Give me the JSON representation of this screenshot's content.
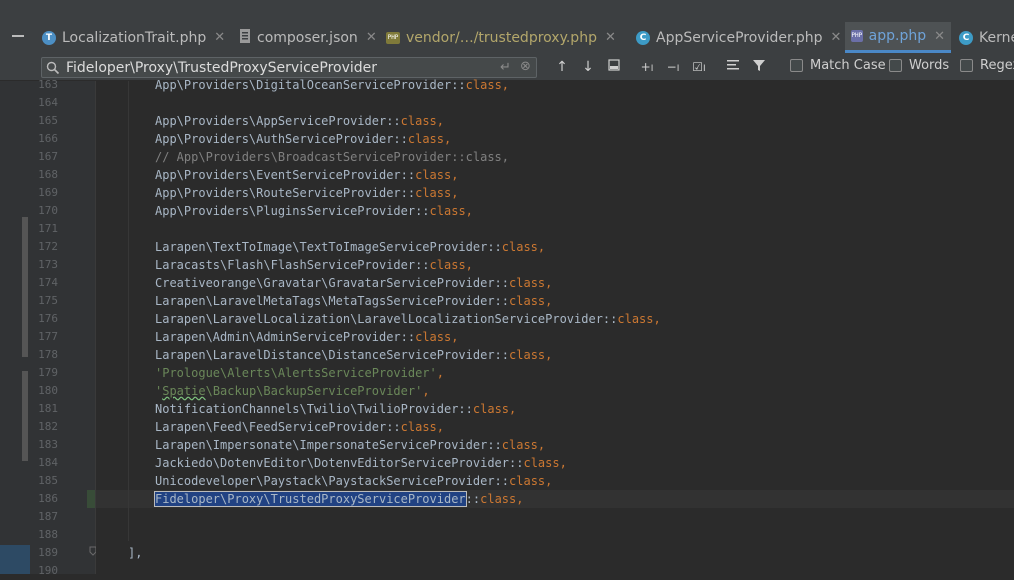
{
  "tabs": [
    {
      "label": "LocalizationTrait.php",
      "icon": "php-trait-icon",
      "active": false,
      "closable": true
    },
    {
      "label": "composer.json",
      "icon": "json-file-icon",
      "active": false,
      "closable": true
    },
    {
      "label": "vendor/…/trustedproxy.php",
      "icon": "php-file-icon",
      "active": false,
      "closable": true
    },
    {
      "label": "AppServiceProvider.php",
      "icon": "php-class-icon",
      "active": false,
      "closable": true
    },
    {
      "label": "app.php",
      "icon": "php-file-icon",
      "active": true,
      "closable": true
    },
    {
      "label": "Kerne",
      "icon": "php-class-icon",
      "active": false,
      "closable": false
    }
  ],
  "search": {
    "value": "Fideloper\\Proxy\\TrustedProxyServiceProvider",
    "match_case_label": "Match Case",
    "words_label": "Words",
    "regex_label": "Regex"
  },
  "lines": [
    {
      "n": "163",
      "segments": [
        {
          "t": "App\\Providers\\DigitalOceanServiceProvider::",
          "c": ""
        },
        {
          "t": "class",
          "c": "kw"
        },
        {
          "t": ",",
          "c": "kw"
        }
      ]
    },
    {
      "n": "164",
      "segments": []
    },
    {
      "n": "165",
      "segments": [
        {
          "t": "App\\Providers\\AppServiceProvider::",
          "c": ""
        },
        {
          "t": "class",
          "c": "kw"
        },
        {
          "t": ",",
          "c": "kw"
        }
      ]
    },
    {
      "n": "166",
      "segments": [
        {
          "t": "App\\Providers\\AuthServiceProvider::",
          "c": ""
        },
        {
          "t": "class",
          "c": "kw"
        },
        {
          "t": ",",
          "c": "kw"
        }
      ]
    },
    {
      "n": "167",
      "segments": [
        {
          "t": "// App\\Providers\\BroadcastServiceProvider::class,",
          "c": "cm"
        }
      ]
    },
    {
      "n": "168",
      "segments": [
        {
          "t": "App\\Providers\\EventServiceProvider::",
          "c": ""
        },
        {
          "t": "class",
          "c": "kw"
        },
        {
          "t": ",",
          "c": "kw"
        }
      ]
    },
    {
      "n": "169",
      "segments": [
        {
          "t": "App\\Providers\\RouteServiceProvider::",
          "c": ""
        },
        {
          "t": "class",
          "c": "kw"
        },
        {
          "t": ",",
          "c": "kw"
        }
      ]
    },
    {
      "n": "170",
      "segments": [
        {
          "t": "App\\Providers\\PluginsServiceProvider::",
          "c": ""
        },
        {
          "t": "class",
          "c": "kw"
        },
        {
          "t": ",",
          "c": "kw"
        }
      ]
    },
    {
      "n": "171",
      "segments": []
    },
    {
      "n": "172",
      "segments": [
        {
          "t": "Larapen\\TextToImage\\TextToImageServiceProvider::",
          "c": ""
        },
        {
          "t": "class",
          "c": "kw"
        },
        {
          "t": ",",
          "c": "kw"
        }
      ]
    },
    {
      "n": "173",
      "segments": [
        {
          "t": "Laracasts\\Flash\\FlashServiceProvider::",
          "c": ""
        },
        {
          "t": "class",
          "c": "kw"
        },
        {
          "t": ",",
          "c": "kw"
        }
      ]
    },
    {
      "n": "174",
      "segments": [
        {
          "t": "Creativeorange\\Gravatar\\GravatarServiceProvider::",
          "c": ""
        },
        {
          "t": "class",
          "c": "kw"
        },
        {
          "t": ",",
          "c": "kw"
        }
      ]
    },
    {
      "n": "175",
      "segments": [
        {
          "t": "Larapen\\LaravelMetaTags\\MetaTagsServiceProvider::",
          "c": ""
        },
        {
          "t": "class",
          "c": "kw"
        },
        {
          "t": ",",
          "c": "kw"
        }
      ]
    },
    {
      "n": "176",
      "segments": [
        {
          "t": "Larapen\\LaravelLocalization\\LaravelLocalizationServiceProvider::",
          "c": ""
        },
        {
          "t": "class",
          "c": "kw"
        },
        {
          "t": ",",
          "c": "kw"
        }
      ]
    },
    {
      "n": "177",
      "segments": [
        {
          "t": "Larapen\\Admin\\AdminServiceProvider::",
          "c": ""
        },
        {
          "t": "class",
          "c": "kw"
        },
        {
          "t": ",",
          "c": "kw"
        }
      ]
    },
    {
      "n": "178",
      "segments": [
        {
          "t": "Larapen\\LaravelDistance\\DistanceServiceProvider::",
          "c": ""
        },
        {
          "t": "class",
          "c": "kw"
        },
        {
          "t": ",",
          "c": "kw"
        }
      ]
    },
    {
      "n": "179",
      "segments": [
        {
          "t": "'Prologue\\Alerts\\AlertsServiceProvider'",
          "c": "str"
        },
        {
          "t": ",",
          "c": "kw"
        }
      ]
    },
    {
      "n": "180",
      "segments": [
        {
          "t": "'",
          "c": "str"
        },
        {
          "t": "Spatie",
          "c": "str squig"
        },
        {
          "t": "\\Backup\\BackupServiceProvider'",
          "c": "str"
        },
        {
          "t": ",",
          "c": "kw"
        }
      ]
    },
    {
      "n": "181",
      "segments": [
        {
          "t": "NotificationChannels\\Twilio\\TwilioProvider::",
          "c": ""
        },
        {
          "t": "class",
          "c": "kw"
        },
        {
          "t": ",",
          "c": "kw"
        }
      ]
    },
    {
      "n": "182",
      "segments": [
        {
          "t": "Larapen\\Feed\\FeedServiceProvider::",
          "c": ""
        },
        {
          "t": "class",
          "c": "kw"
        },
        {
          "t": ",",
          "c": "kw"
        }
      ]
    },
    {
      "n": "183",
      "segments": [
        {
          "t": "Larapen\\Impersonate\\ImpersonateServiceProvider::",
          "c": ""
        },
        {
          "t": "class",
          "c": "kw"
        },
        {
          "t": ",",
          "c": "kw"
        }
      ]
    },
    {
      "n": "184",
      "segments": [
        {
          "t": "Jackiedo\\DotenvEditor\\DotenvEditorServiceProvider::",
          "c": ""
        },
        {
          "t": "class",
          "c": "kw"
        },
        {
          "t": ",",
          "c": "kw"
        }
      ]
    },
    {
      "n": "185",
      "segments": [
        {
          "t": "Unicodeveloper\\Paystack\\PaystackServiceProvider::",
          "c": ""
        },
        {
          "t": "class",
          "c": "kw"
        },
        {
          "t": ",",
          "c": "kw"
        }
      ]
    },
    {
      "n": "186",
      "segments": [
        {
          "t": "Fideloper\\Proxy\\TrustedProxyServiceProvider",
          "c": "match"
        },
        {
          "t": "::",
          "c": ""
        },
        {
          "t": "class",
          "c": "kw"
        },
        {
          "t": ",",
          "c": "kw"
        }
      ]
    },
    {
      "n": "187",
      "segments": []
    },
    {
      "n": "188",
      "segments": []
    },
    {
      "n": "189",
      "segments": [
        {
          "t": "],",
          "c": ""
        }
      ],
      "outdent": true
    },
    {
      "n": "190",
      "segments": []
    }
  ]
}
